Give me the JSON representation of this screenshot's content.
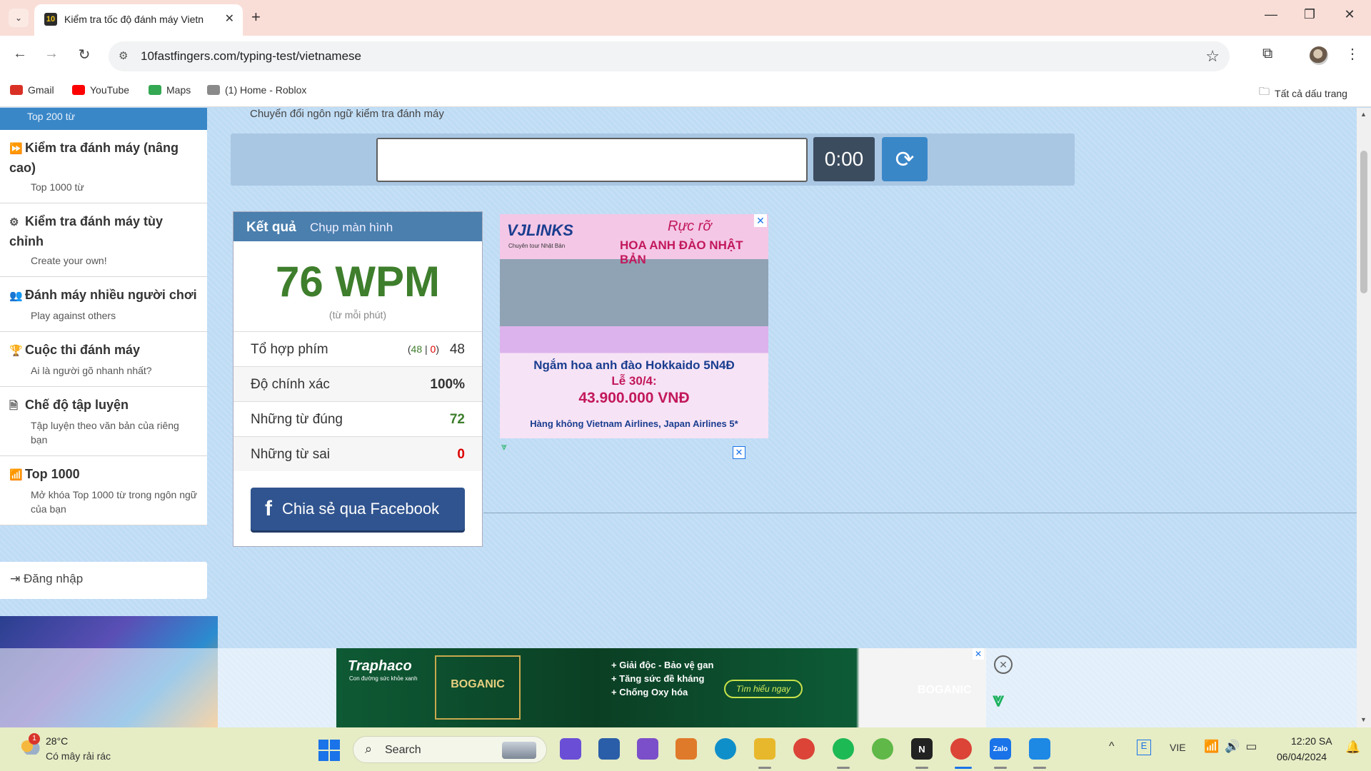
{
  "browser": {
    "tab_title": "Kiểm tra tốc độ đánh máy Vietn",
    "tab_close": "✕",
    "new_tab": "+",
    "url": "10fastfingers.com/typing-test/vietnamese",
    "controls": {
      "minimize": "—",
      "maximize": "❐",
      "close": "✕"
    }
  },
  "bookmarks": [
    {
      "label": "Gmail",
      "icon": "gmail-icon",
      "color": "#d93025"
    },
    {
      "label": "YouTube",
      "icon": "youtube-icon",
      "color": "#ff0000"
    },
    {
      "label": "Maps",
      "icon": "maps-icon",
      "color": "#34a853"
    },
    {
      "label": "(1) Home - Roblox",
      "icon": "roblox-icon",
      "color": "#777777"
    }
  ],
  "all_bookmarks": "Tất cả dấu trang",
  "sidebar": {
    "top_sub": "Top 200 từ",
    "items": [
      {
        "title": "Kiểm tra đánh máy (nâng cao)",
        "sub": "Top 1000 từ",
        "icon": "forward-icon",
        "glyph": "⏩"
      },
      {
        "title": "Kiểm tra đánh máy tùy chỉnh",
        "sub": "Create your own!",
        "icon": "cogs-icon",
        "glyph": "⚙"
      },
      {
        "title": "Đánh máy nhiều người chơi",
        "sub": "Play against others",
        "icon": "users-icon",
        "glyph": "👥"
      },
      {
        "title": "Cuộc thi đánh máy",
        "sub": "Ai là người gõ nhanh nhất?",
        "icon": "trophy-icon",
        "glyph": "🏆"
      },
      {
        "title": "Chế độ tập luyện",
        "sub": "Tập luyện theo văn bản của riêng bạn",
        "icon": "document-icon",
        "glyph": "🗎"
      },
      {
        "title": "Top 1000",
        "sub": "Mở khóa Top 1000 từ trong ngôn ngữ của bạn",
        "icon": "signal-icon",
        "glyph": "📶"
      }
    ],
    "login": "Đăng nhập"
  },
  "main": {
    "lang_switch": "Chuyển đổi ngôn ngữ kiểm tra đánh máy",
    "input_value": "",
    "timer": "0:00",
    "result": {
      "tab_result": "Kết quả",
      "tab_screenshot": "Chụp màn hình",
      "wpm": "76 WPM",
      "wpm_sub": "(từ mỗi phút)",
      "rows": {
        "keystrokes_label": "Tổ hợp phím",
        "keystrokes_correct": "48",
        "keystrokes_wrong": "0",
        "keystrokes_value": "48",
        "accuracy_label": "Độ chính xác",
        "accuracy_value": "100%",
        "correct_label": "Những từ đúng",
        "correct_value": "72",
        "wrong_label": "Những từ sai",
        "wrong_value": "0"
      },
      "facebook": "Chia sẻ qua Facebook"
    }
  },
  "ad": {
    "logo": "VJLINKS",
    "logo_sub": "Chuyên tour Nhật Bản",
    "script": "Rực rỡ",
    "heading": "HOA ANH ĐÀO NHẬT BẢN",
    "line1": "Ngắm hoa anh đào Hokkaido 5N4Đ",
    "line2": "Lễ 30/4:",
    "line3": "43.900.000 VNĐ",
    "line4": "Hàng không Vietnam Airlines, Japan Airlines 5*"
  },
  "bottom_ad": {
    "brand": "Traphaco",
    "brand_sub": "Con đường sức khỏe xanh",
    "product": "BOGANIC",
    "features": [
      "+ Giải độc - Bảo vệ gan",
      "+ Tăng sức đề kháng",
      "+ Chống Oxy hóa"
    ],
    "cta": "Tìm hiểu ngay",
    "brand2": "BOGANIC"
  },
  "taskbar": {
    "weather_badge": "1",
    "temp": "28°C",
    "desc": "Có mây rải rác",
    "search": "Search",
    "apps": [
      {
        "name": "copilot-icon",
        "color": "#6a4fd6",
        "glyph": ""
      },
      {
        "name": "store-icon",
        "color": "#2b5ea8",
        "glyph": ""
      },
      {
        "name": "visual-studio-icon",
        "color": "#7b4fc9",
        "glyph": ""
      },
      {
        "name": "snip-icon",
        "color": "#e07a2b",
        "glyph": ""
      },
      {
        "name": "edge-icon",
        "color": "#0f8fc9",
        "glyph": ""
      },
      {
        "name": "file-explorer-icon",
        "color": "#e8b82c",
        "glyph": ""
      },
      {
        "name": "chrome-icon",
        "color": "#db4437",
        "glyph": ""
      },
      {
        "name": "spotify-icon",
        "color": "#1db954",
        "glyph": ""
      },
      {
        "name": "app-green-icon",
        "color": "#5fb847",
        "glyph": ""
      },
      {
        "name": "notion-icon",
        "color": "#222222",
        "glyph": "N"
      },
      {
        "name": "chrome-active-icon",
        "color": "#db4437",
        "glyph": ""
      },
      {
        "name": "zalo-icon",
        "color": "#1a73e8",
        "glyph": "Zalo"
      },
      {
        "name": "paint-icon",
        "color": "#1e88e5",
        "glyph": ""
      }
    ],
    "ime": "E",
    "lang": "VIE",
    "time": "12:20 SA",
    "date": "06/04/2024"
  }
}
